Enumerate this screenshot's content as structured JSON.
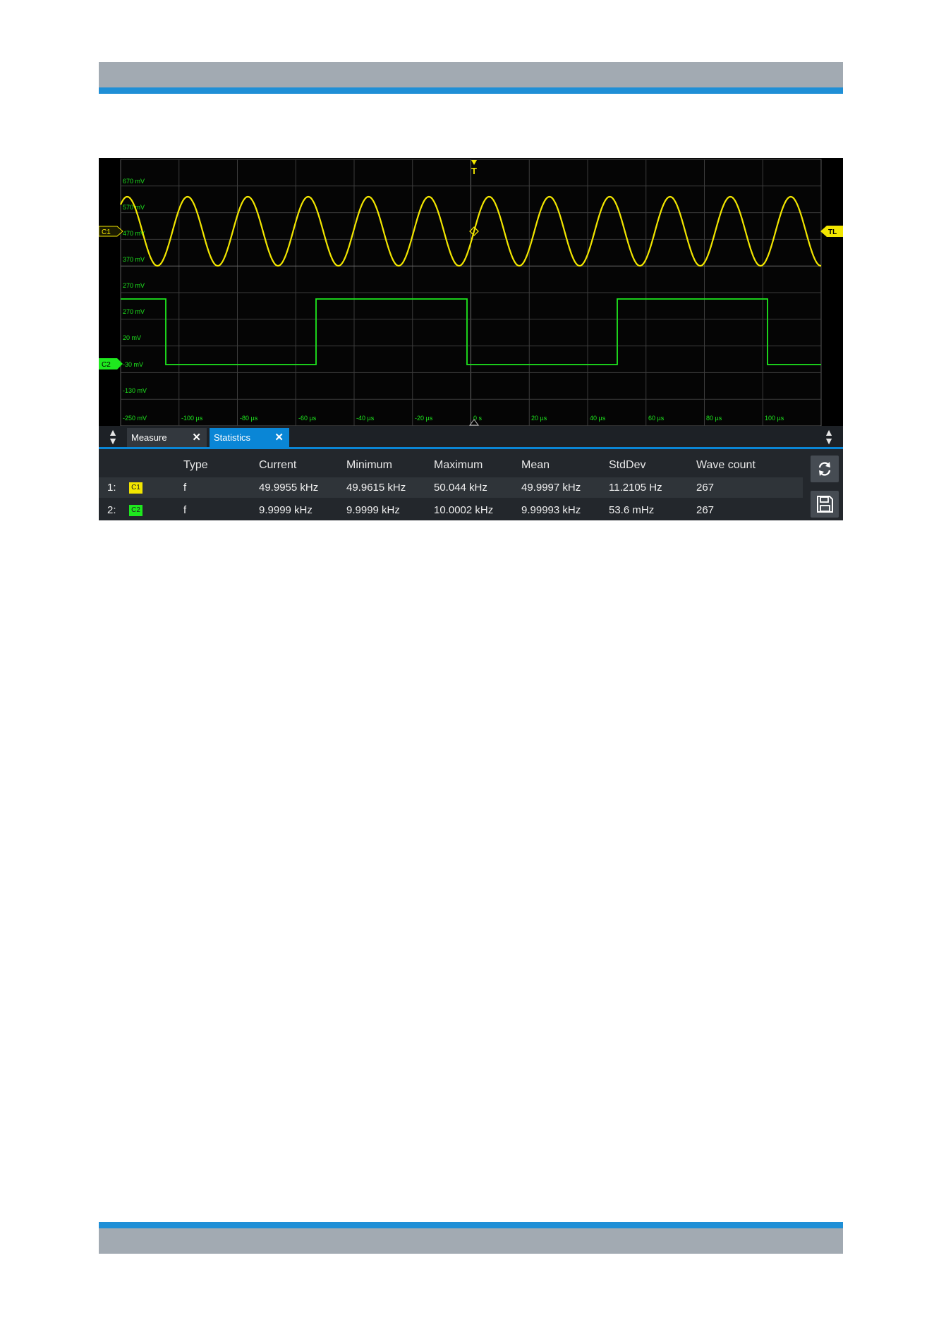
{
  "scope": {
    "channel_badges": {
      "c1": "C1",
      "c2": "C2",
      "trigger_level": "TL",
      "trigger": "T"
    },
    "y_labels": [
      "670 mV",
      "570 mV",
      "470 mV",
      "370 mV",
      "270 mV",
      "270 mV",
      "20 mV",
      "-30 mV",
      "-130 mV",
      "-250 mV"
    ],
    "x_labels": [
      "-100 µs",
      "-80 µs",
      "-60 µs",
      "-40 µs",
      "-20 µs",
      "0 s",
      "20 µs",
      "40 µs",
      "60 µs",
      "80 µs",
      "100 µs"
    ],
    "colors": {
      "c1": "#f2e600",
      "c2": "#1ee81e",
      "grid": "#3c3c3c",
      "background": "#000000"
    }
  },
  "tabs": [
    {
      "label": "Measure",
      "close": "✕"
    },
    {
      "label": "Statistics",
      "close": "✕"
    }
  ],
  "table": {
    "headers": [
      "Type",
      "Current",
      "Minimum",
      "Maximum",
      "Mean",
      "StdDev",
      "Wave count"
    ],
    "rows": [
      {
        "index": "1:",
        "source": "C1",
        "type": "f",
        "current": "49.9955 kHz",
        "minimum": "49.9615 kHz",
        "maximum": "50.044 kHz",
        "mean": "49.9997 kHz",
        "stddev": "11.2105 Hz",
        "wave_count": "267"
      },
      {
        "index": "2:",
        "source": "C2",
        "type": "f",
        "current": "9.9999 kHz",
        "minimum": "9.9999 kHz",
        "maximum": "10.0002 kHz",
        "mean": "9.99993 kHz",
        "stddev": "53.6 mHz",
        "wave_count": "267"
      }
    ]
  },
  "icons": {
    "reset": "refresh-icon",
    "save": "floppy-disk-icon",
    "panel_toggle": "up-down-arrows-icon"
  }
}
